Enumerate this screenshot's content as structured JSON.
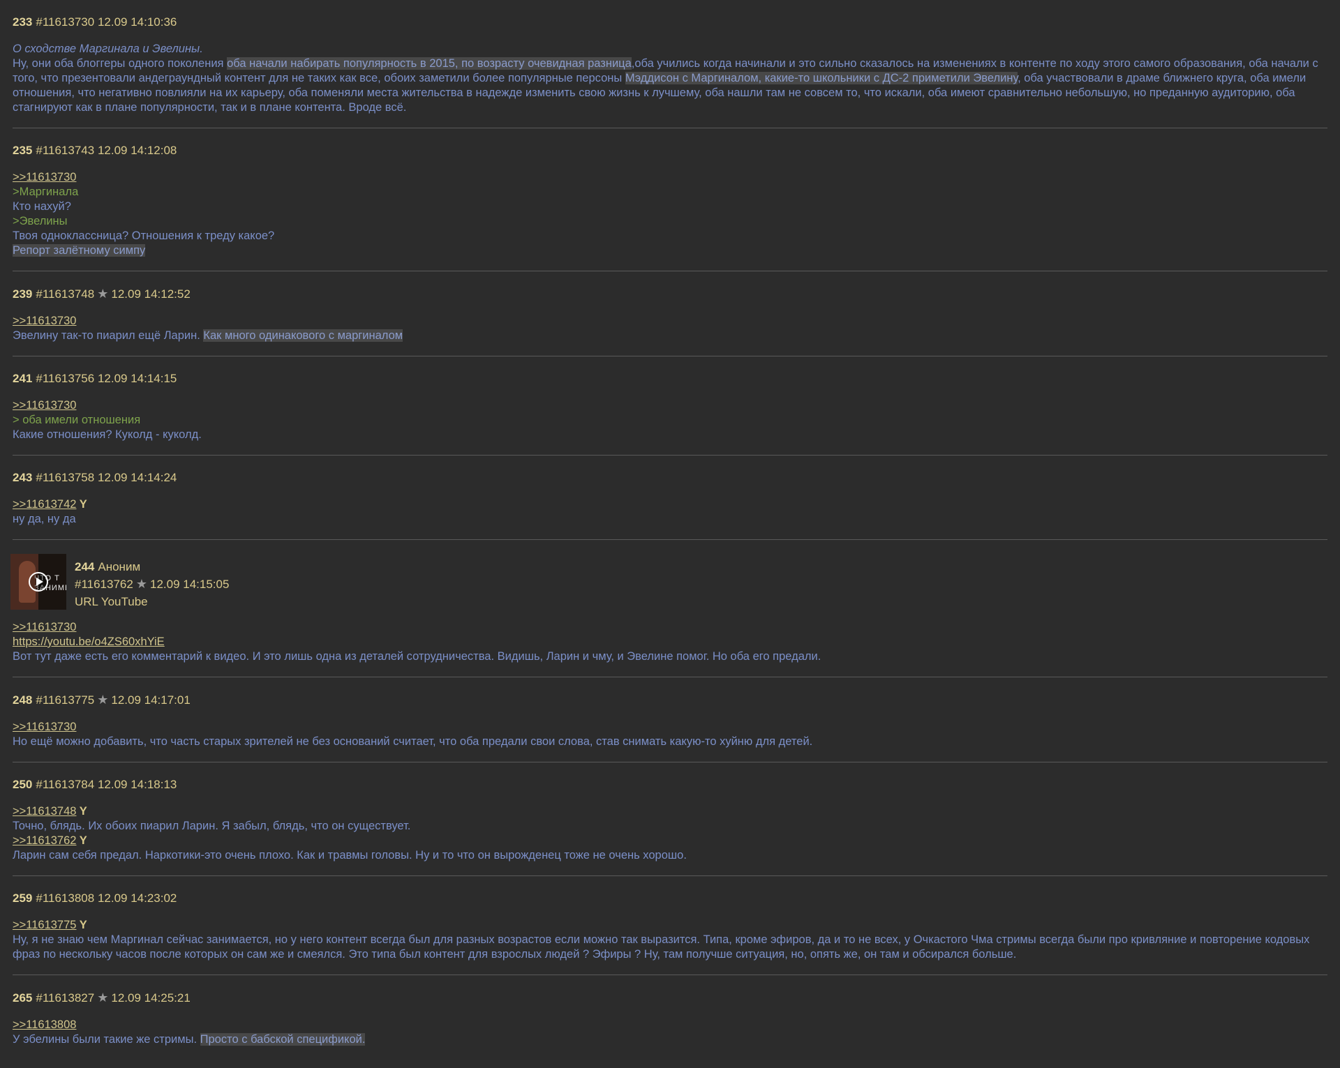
{
  "posts": [
    {
      "num": "233",
      "id": "#11613730",
      "date": "12.09 14:10:36",
      "star": false,
      "lines": [
        {
          "segs": [
            {
              "t": "О сходстве Маргинала и Эвелины.",
              "k": "em"
            }
          ]
        },
        {
          "segs": [
            {
              "t": "Ну, они оба блоггеры одного поколения ",
              "k": "txt"
            },
            {
              "t": "оба начали набирать популярность в 2015, по возрасту очевидная разница",
              "k": "spoiler"
            },
            {
              "t": ",оба учились когда начинали и это сильно сказалось на изменениях в контенте по ходу этого самого образования, оба начали с того, что презентовали андеграундный контент для не таких как все, обоих заметили более популярные персоны ",
              "k": "txt"
            },
            {
              "t": "Мэддисон с Маргиналом, какие-то школьники с ДС-2 приметили Эвелину",
              "k": "spoiler"
            },
            {
              "t": ", оба участвовали в драме ближнего круга, оба имели отношения, что негативно повлияли на их карьеру, оба поменяли места жительства в надежде изменить свою жизнь к лучшему, оба нашли там не совсем то, что искали, оба имеют сравнительно небольшую, но преданную аудиторию, оба стагнируют как в плане популярности, так и в плане контента. Вроде всё.",
              "k": "txt"
            }
          ]
        }
      ]
    },
    {
      "num": "235",
      "id": "#11613743",
      "date": "12.09 14:12:08",
      "star": false,
      "lines": [
        {
          "segs": [
            {
              "t": ">>11613730",
              "k": "reply"
            }
          ]
        },
        {
          "segs": [
            {
              "t": ">Маргинала",
              "k": "quote"
            }
          ]
        },
        {
          "segs": [
            {
              "t": "Кто нахуй?",
              "k": "txt"
            }
          ]
        },
        {
          "segs": [
            {
              "t": ">Эвелины",
              "k": "quote"
            }
          ]
        },
        {
          "segs": [
            {
              "t": "Твоя одноклассница? Отношения к треду какое?",
              "k": "txt"
            }
          ]
        },
        {
          "segs": [
            {
              "t": "Репорт залётному симпу",
              "k": "spoiler"
            }
          ]
        }
      ]
    },
    {
      "num": "239",
      "id": "#11613748",
      "date": "12.09 14:12:52",
      "star": true,
      "lines": [
        {
          "segs": [
            {
              "t": ">>11613730",
              "k": "reply"
            }
          ]
        },
        {
          "segs": [
            {
              "t": "Эвелину так-то пиарил ещё Ларин. ",
              "k": "txt"
            },
            {
              "t": "Как много одинакового с маргиналом",
              "k": "spoiler"
            }
          ]
        }
      ]
    },
    {
      "num": "241",
      "id": "#11613756",
      "date": "12.09 14:14:15",
      "star": false,
      "lines": [
        {
          "segs": [
            {
              "t": ">>11613730",
              "k": "reply"
            }
          ]
        },
        {
          "segs": [
            {
              "t": "> оба имели отношения",
              "k": "quote"
            }
          ]
        },
        {
          "segs": [
            {
              "t": "Какие отношения? Куколд - куколд.",
              "k": "txt"
            }
          ]
        }
      ]
    },
    {
      "num": "243",
      "id": "#11613758",
      "date": "12.09 14:14:24",
      "star": false,
      "lines": [
        {
          "segs": [
            {
              "t": ">>11613742",
              "k": "reply"
            },
            {
              "t": " Y",
              "k": "you"
            }
          ]
        },
        {
          "segs": [
            {
              "t": "ну да, ну да",
              "k": "txt"
            }
          ]
        }
      ]
    },
    {
      "num": "244",
      "id": "#11613762",
      "date": "12.09 14:15:05",
      "star": true,
      "media": {
        "author": "Аноним",
        "source": "URL YouTube",
        "thumb_text": "ЧТО Т ЗАНИМЕСЯ"
      },
      "lines": [
        {
          "segs": [
            {
              "t": ">>11613730",
              "k": "reply"
            }
          ]
        },
        {
          "segs": [
            {
              "t": "https://youtu.be/o4ZS60xhYiE",
              "k": "link"
            }
          ]
        },
        {
          "segs": [
            {
              "t": "Вот тут даже есть его комментарий к видео. И это лишь одна из деталей сотрудничества. Видишь, Ларин и чму, и Эвелине помог. Но оба его предали.",
              "k": "txt"
            }
          ]
        }
      ]
    },
    {
      "num": "248",
      "id": "#11613775",
      "date": "12.09 14:17:01",
      "star": true,
      "lines": [
        {
          "segs": [
            {
              "t": ">>11613730",
              "k": "reply"
            }
          ]
        },
        {
          "segs": [
            {
              "t": "Но ещё можно добавить, что часть старых зрителей не без оснований считает, что оба предали свои слова, став снимать какую-то хуйню для детей.",
              "k": "txt"
            }
          ]
        }
      ]
    },
    {
      "num": "250",
      "id": "#11613784",
      "date": "12.09 14:18:13",
      "star": false,
      "lines": [
        {
          "segs": [
            {
              "t": ">>11613748",
              "k": "reply"
            },
            {
              "t": " Y",
              "k": "you"
            }
          ]
        },
        {
          "segs": [
            {
              "t": "Точно, блядь. Их обоих пиарил Ларин. Я забыл, блядь, что он существует.",
              "k": "txt"
            }
          ]
        },
        {
          "segs": [
            {
              "t": ">>11613762",
              "k": "reply"
            },
            {
              "t": " Y",
              "k": "you"
            }
          ]
        },
        {
          "segs": [
            {
              "t": "Ларин сам себя предал. Наркотики-это очень плохо. Как и травмы головы. Ну и то что он вырожденец тоже не очень хорошо.",
              "k": "txt"
            }
          ]
        }
      ]
    },
    {
      "num": "259",
      "id": "#11613808",
      "date": "12.09 14:23:02",
      "star": false,
      "lines": [
        {
          "segs": [
            {
              "t": ">>11613775",
              "k": "reply"
            },
            {
              "t": " Y",
              "k": "you"
            }
          ]
        },
        {
          "segs": [
            {
              "t": "Ну, я не знаю чем Маргинал сейчас занимается, но у него контент всегда был для разных возрастов если можно так выразится. Типа, кроме эфиров, да и то не всех, у Очкастого Чма стримы всегда были про кривляние и повторение кодовых фраз по нескольку часов после которых он сам же и смеялся. Это типа был контент для взрослых людей ? Эфиры ? Ну, там получше ситуация, но, опять же, он там и обсирался больше.",
              "k": "txt"
            }
          ]
        }
      ]
    },
    {
      "num": "265",
      "id": "#11613827",
      "date": "12.09 14:25:21",
      "star": true,
      "lines": [
        {
          "segs": [
            {
              "t": ">>11613808",
              "k": "reply"
            }
          ]
        },
        {
          "segs": [
            {
              "t": "У эбелины были такие же стримы. ",
              "k": "txt"
            },
            {
              "t": "Просто с бабской спецификой.",
              "k": "spoiler"
            }
          ]
        }
      ]
    }
  ]
}
